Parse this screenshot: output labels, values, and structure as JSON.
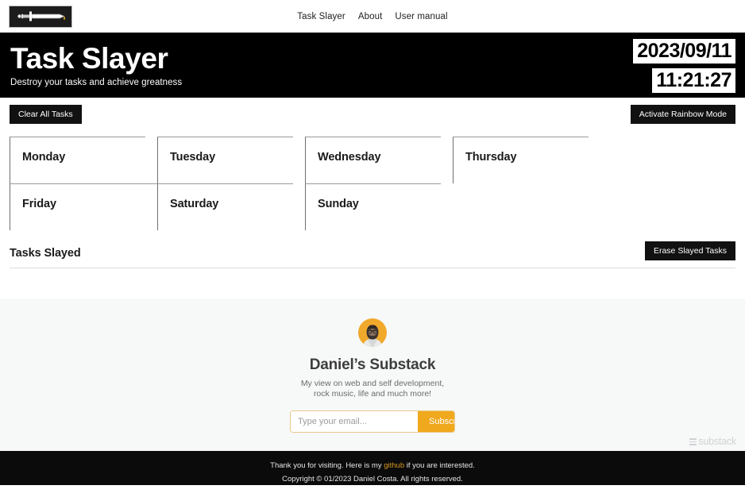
{
  "navbar": {
    "logo_icon": "sword-icon",
    "links": [
      {
        "label": "Task Slayer"
      },
      {
        "label": "About"
      },
      {
        "label": "User manual"
      }
    ]
  },
  "hero": {
    "title": "Task Slayer",
    "subtitle": "Destroy your tasks and achieve greatness",
    "date": "2023/09/11",
    "time": "11:21:27",
    "background_color": "#000000"
  },
  "controls": {
    "clear_all_label": "Clear All Tasks",
    "rainbow_label": "Activate Rainbow Mode"
  },
  "days": [
    {
      "name": "Monday",
      "tasks": []
    },
    {
      "name": "Tuesday",
      "tasks": []
    },
    {
      "name": "Wednesday",
      "tasks": []
    },
    {
      "name": "Thursday",
      "tasks": []
    },
    {
      "name": "Friday",
      "tasks": []
    },
    {
      "name": "Saturday",
      "tasks": []
    },
    {
      "name": "Sunday",
      "tasks": []
    }
  ],
  "slayed": {
    "title": "Tasks Slayed",
    "erase_label": "Erase Slayed Tasks",
    "items": []
  },
  "substack": {
    "avatar_icon": "user-avatar",
    "title": "Daniel’s Substack",
    "desc_line1": "My view on web and self development,",
    "desc_line2": "rock music, life and much more!",
    "email_placeholder": "Type your email...",
    "email_value": "",
    "subscribe_label": "Subscribe",
    "watermark": "substack",
    "accent_color": "#f0a81d"
  },
  "footer": {
    "line1_pre": "Thank you for visiting. Here is my ",
    "line1_link": "github",
    "line1_post": " if you are interested.",
    "line2": "Copyright © 01/2023 Daniel Costa. All rights reserved.",
    "link_color": "#d99a1e"
  }
}
